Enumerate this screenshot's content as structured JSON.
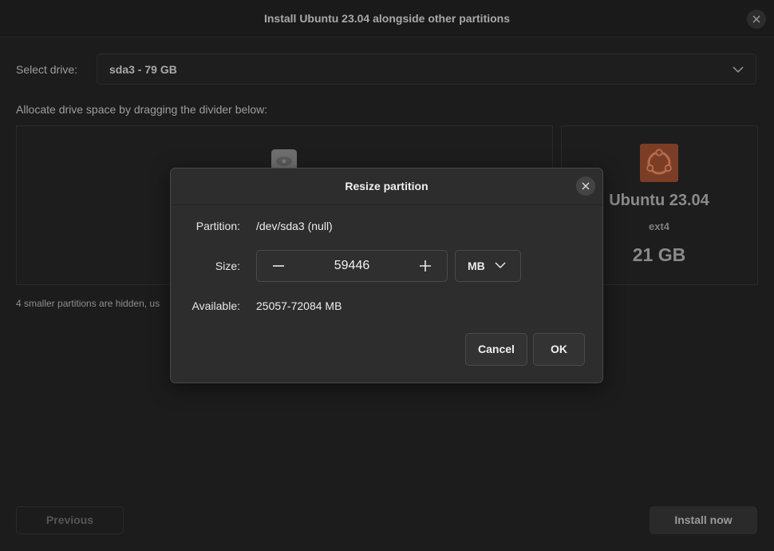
{
  "window": {
    "title": "Install Ubuntu 23.04 alongside other partitions",
    "close_icon": "close-icon"
  },
  "drive": {
    "label": "Select drive:",
    "value": "sda3 - 79 GB"
  },
  "allocate_label": "Allocate drive space by dragging the divider below:",
  "new_partition": {
    "os_name": "Ubuntu 23.04",
    "filesystem": "ext4",
    "size": "21 GB",
    "logo_color": "#7b3d25"
  },
  "hidden_note": "4 smaller partitions are hidden, us",
  "footer": {
    "previous_label": "Previous",
    "install_label": "Install now"
  },
  "dialog": {
    "title": "Resize partition",
    "partition_label": "Partition:",
    "partition_value": "/dev/sda3 (null)",
    "size_label": "Size:",
    "size_value": "59446",
    "unit_value": "MB",
    "available_label": "Available:",
    "available_value": "25057-72084 MB",
    "cancel_label": "Cancel",
    "ok_label": "OK"
  }
}
